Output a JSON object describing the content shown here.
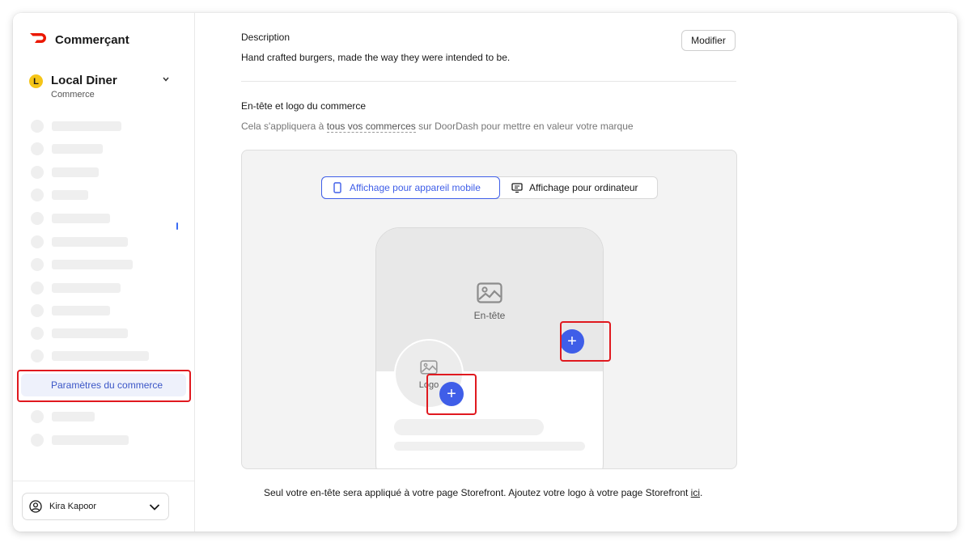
{
  "brand": {
    "name": "Commerçant",
    "color": "#eb1700"
  },
  "store": {
    "initial": "L",
    "name": "Local Diner",
    "subtitle": "Commerce"
  },
  "nav": {
    "active_label": "Paramètres du commerce"
  },
  "user": {
    "name": "Kira Kapoor"
  },
  "description": {
    "label": "Description",
    "text": "Hand crafted burgers, made the way they were intended to be.",
    "edit_label": "Modifier"
  },
  "header_logo": {
    "label": "En-tête et logo du commerce",
    "help_prefix": "Cela s'appliquera à ",
    "help_link": "tous vos commerces",
    "help_suffix": " sur DoorDash pour mettre en valeur votre marque",
    "tab_mobile": "Affichage pour appareil mobile",
    "tab_desktop": "Affichage pour ordinateur",
    "header_placeholder": "En-tête",
    "logo_placeholder": "Logo",
    "add_symbol": "+"
  },
  "footnote": {
    "text": "Seul votre en-tête sera appliqué à votre page Storefront. Ajoutez votre logo à votre page Storefront ",
    "link": "ici",
    "end": "."
  },
  "colors": {
    "accent": "#3f5ee8",
    "highlight": "#e0191f"
  }
}
